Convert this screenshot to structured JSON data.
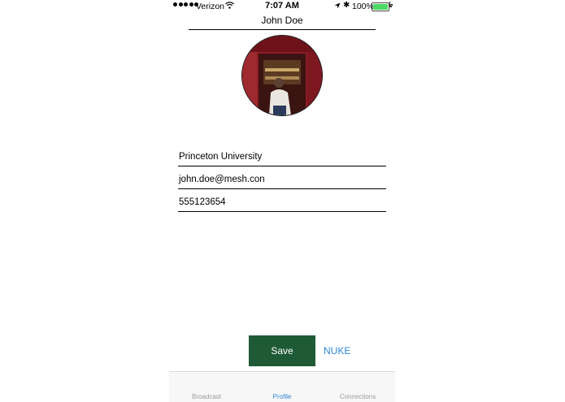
{
  "status_bar": {
    "carrier": "Verizon",
    "time": "7:07 AM",
    "battery": "100%",
    "signal_icon": "signal-dots-icon",
    "wifi_icon": "wifi-icon",
    "location_icon": "location-arrow-icon",
    "bluetooth_icon": "bluetooth-icon",
    "battery_color": "#4cd964"
  },
  "profile": {
    "name": "John Doe",
    "school": "Princeton University",
    "email": "john.doe@mesh.con",
    "phone": "555123654"
  },
  "actions": {
    "save_label": "Save",
    "nuke_label": "NUKE",
    "save_color": "#1f5a36",
    "link_color": "#2f88d6"
  },
  "tabs": [
    {
      "label": "Broadcast"
    },
    {
      "label": "Profile",
      "active": true
    },
    {
      "label": "Connections"
    }
  ]
}
